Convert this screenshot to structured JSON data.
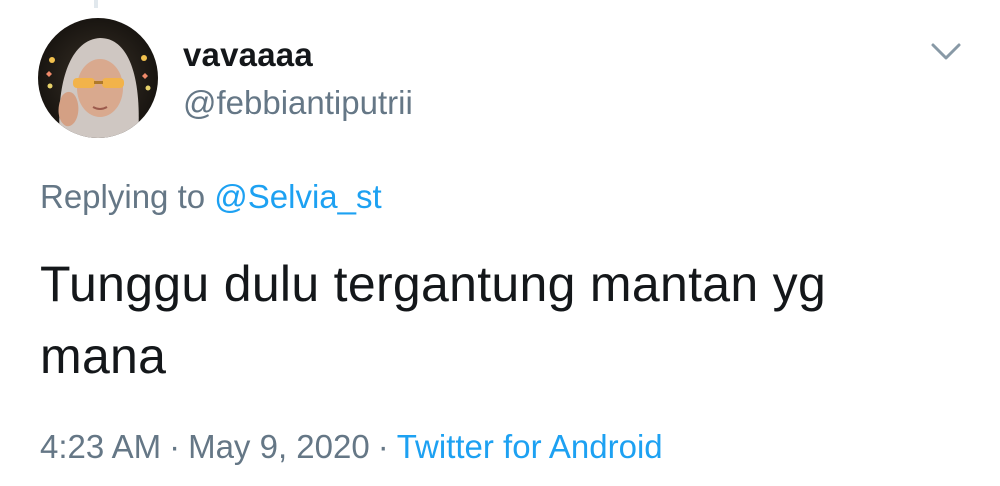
{
  "user": {
    "display_name": "vavaaaa",
    "handle": "@febbiantiputrii"
  },
  "reply": {
    "prefix": "Replying to",
    "mention": "@Selvia_st"
  },
  "tweet": {
    "text": "Tunggu dulu tergantung mantan yg mana"
  },
  "meta": {
    "time": "4:23 AM",
    "separator": "·",
    "date": "May 9, 2020",
    "source": "Twitter for Android"
  },
  "icons": {
    "menu": "chevron-down-icon",
    "avatar": "avatar"
  },
  "colors": {
    "text": "#14171a",
    "secondary": "#657786",
    "link": "#1da1f2"
  }
}
